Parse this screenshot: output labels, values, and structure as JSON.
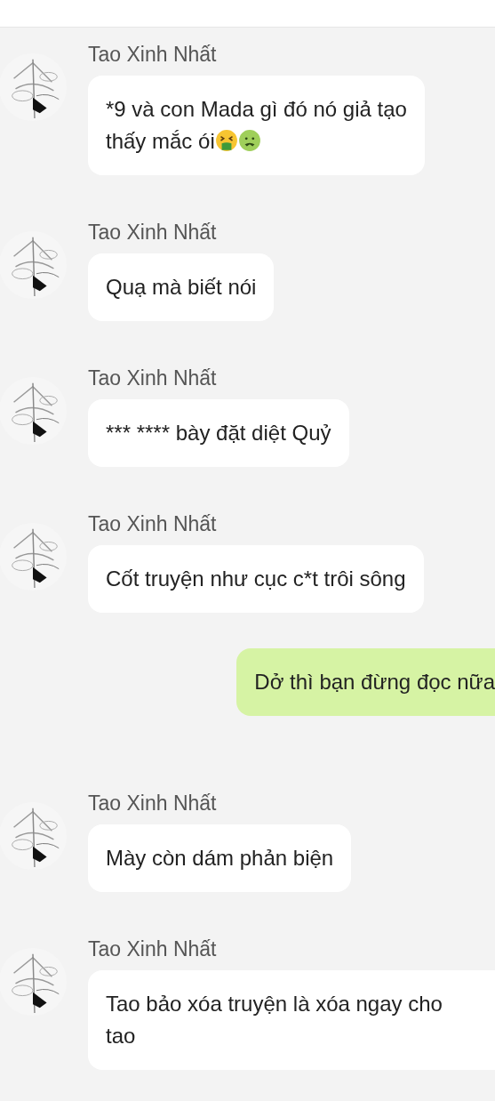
{
  "messages": [
    {
      "kind": "incoming",
      "sender": "Tao Xinh Nhất",
      "text": "*9 và con Mada gì đó nó giả tạo\nthấy mắc ói",
      "emojis": [
        {
          "kind": "vomiting"
        },
        {
          "kind": "nauseated"
        }
      ]
    },
    {
      "kind": "incoming",
      "sender": "Tao Xinh Nhất",
      "text": "Quạ mà biết nói"
    },
    {
      "kind": "incoming",
      "sender": "Tao Xinh Nhất",
      "text": "*** **** bày đặt diệt Quỷ"
    },
    {
      "kind": "incoming",
      "sender": "Tao Xinh Nhất",
      "text": "Cốt truyện như cục c*t trôi sông"
    },
    {
      "kind": "outgoing",
      "text": "Dở thì bạn đừng đọc nữa"
    },
    {
      "kind": "incoming",
      "sender": "Tao Xinh Nhất",
      "text": "Mày còn dám phản biện"
    },
    {
      "kind": "incoming",
      "sender": "Tao Xinh Nhất",
      "text": "Tao bảo xóa truyện là xóa ngay cho\ntao"
    }
  ]
}
